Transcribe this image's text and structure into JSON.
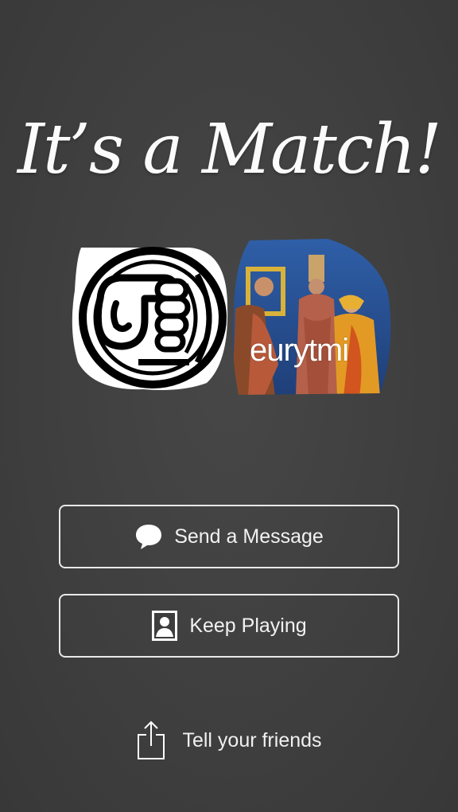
{
  "screen": {
    "title": "It's a Match!",
    "title_display": "It’s a Match!"
  },
  "matches": {
    "left_avatar_icon": "fist-bump-icon",
    "right_avatar_username": "eurytmi"
  },
  "actions": {
    "send_message_label": "Send a Message",
    "send_message_icon": "chat-bubble-icon",
    "keep_playing_label": "Keep Playing",
    "keep_playing_icon": "profile-card-icon",
    "tell_friends_label": "Tell your friends",
    "tell_friends_icon": "share-icon"
  },
  "colors": {
    "background": "#3d3d3d",
    "text": "#ffffff",
    "button_border": "#e9e9e9"
  }
}
